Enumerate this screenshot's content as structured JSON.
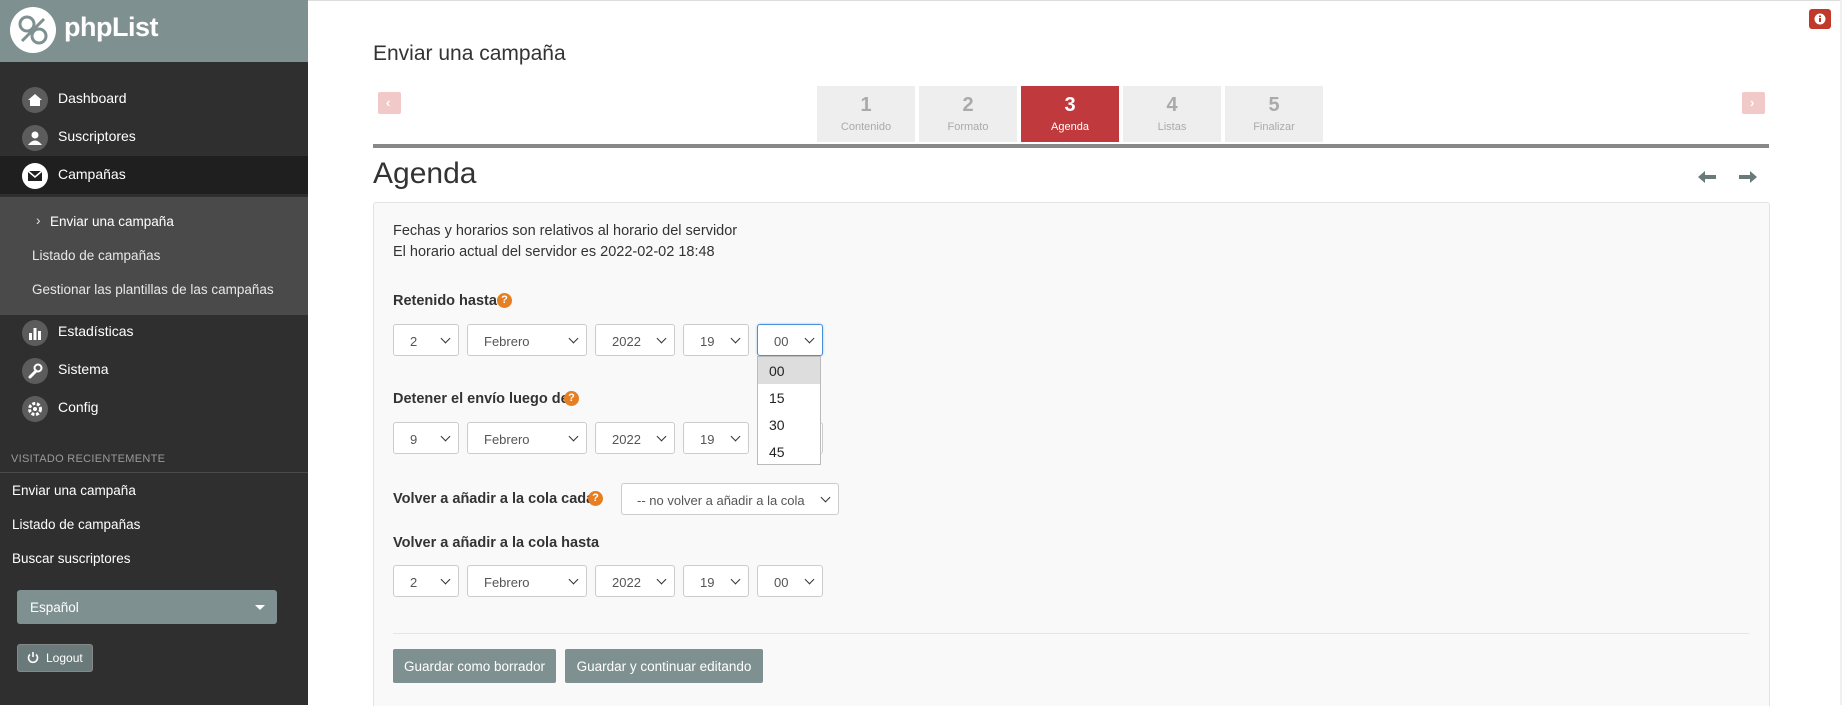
{
  "app": {
    "logo_text": "phpList"
  },
  "sidebar": {
    "nav": [
      {
        "label": "Dashboard",
        "icon": "home-icon"
      },
      {
        "label": "Suscriptores",
        "icon": "user-icon"
      },
      {
        "label": "Campañas",
        "icon": "envelope-icon",
        "active": true
      },
      {
        "label": "Estadísticas",
        "icon": "bar-chart-icon"
      },
      {
        "label": "Sistema",
        "icon": "wrench-icon"
      },
      {
        "label": "Config",
        "icon": "gear-icon"
      }
    ],
    "submenu": [
      {
        "label": "Enviar una campaña",
        "current": true
      },
      {
        "label": "Listado de campañas"
      },
      {
        "label": "Gestionar las plantillas de las campañas"
      }
    ],
    "recent_title": "VISITADO RECIENTEMENTE",
    "recent": [
      "Enviar una campaña",
      "Listado de campañas",
      "Buscar suscriptores"
    ],
    "language": "Español",
    "logout": "Logout"
  },
  "main": {
    "title": "Enviar una campaña",
    "steps": [
      {
        "num": "1",
        "name": "Contenido"
      },
      {
        "num": "2",
        "name": "Formato"
      },
      {
        "num": "3",
        "name": "Agenda",
        "active": true
      },
      {
        "num": "4",
        "name": "Listas"
      },
      {
        "num": "5",
        "name": "Finalizar"
      }
    ],
    "section_title": "Agenda",
    "info": [
      "Fechas y horarios son relativos al horario del servidor",
      "El horario actual del servidor es 2022-02-02 18:48"
    ],
    "embargo": {
      "label": "Retenido hasta",
      "day": "2",
      "month": "Febrero",
      "year": "2022",
      "hour": "19",
      "minute": "00"
    },
    "minute_options": [
      "00",
      "15",
      "30",
      "45"
    ],
    "finish": {
      "label": "Detener el envío luego de",
      "day": "9",
      "month": "Febrero",
      "year": "2022",
      "hour": "19"
    },
    "requeue": {
      "label": "Volver a añadir a la cola cada",
      "value": "-- no volver a añadir a la cola"
    },
    "requeue_until": {
      "label": "Volver a añadir a la cola hasta",
      "day": "2",
      "month": "Febrero",
      "year": "2022",
      "hour": "19",
      "minute": "00"
    },
    "buttons": {
      "save_draft": "Guardar como borrador",
      "save_continue": "Guardar y continuar editando"
    }
  },
  "colors": {
    "accent_red": "#c0393d",
    "sidebar_dark": "#2f2f2f",
    "brand_teal": "#7e9090",
    "help_orange": "#e67e22"
  }
}
